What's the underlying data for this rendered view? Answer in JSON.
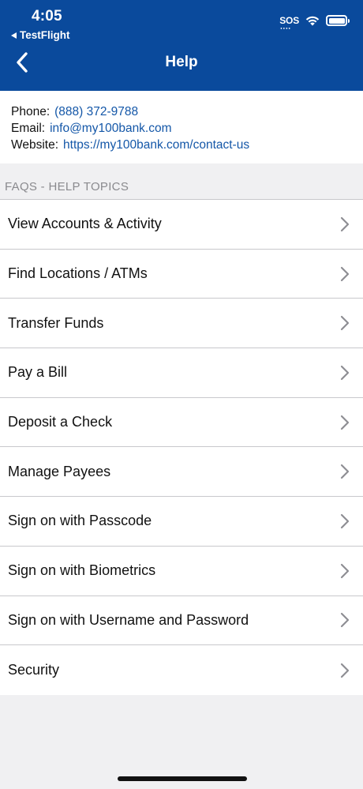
{
  "status_bar": {
    "time": "4:05",
    "back_app": "TestFlight",
    "sos": "SOS"
  },
  "nav": {
    "title": "Help",
    "back_icon": "chevron-left-icon"
  },
  "contact": {
    "phone_label": "Phone:",
    "phone": "(888) 372-9788",
    "email_label": "Email:",
    "email": "info@my100bank.com",
    "website_label": "Website:",
    "website": "https://my100bank.com/contact-us"
  },
  "faqs": {
    "header": "FAQS - HELP TOPICS",
    "items": [
      "View Accounts & Activity",
      "Find Locations / ATMs",
      "Transfer Funds",
      "Pay a Bill",
      "Deposit a Check",
      "Manage Payees",
      "Sign on with Passcode",
      "Sign on with Biometrics",
      "Sign on with Username and Password",
      "Security"
    ]
  },
  "colors": {
    "header_bg": "#0a4a9c",
    "link": "#1457a8",
    "background": "#f0f0f2"
  }
}
